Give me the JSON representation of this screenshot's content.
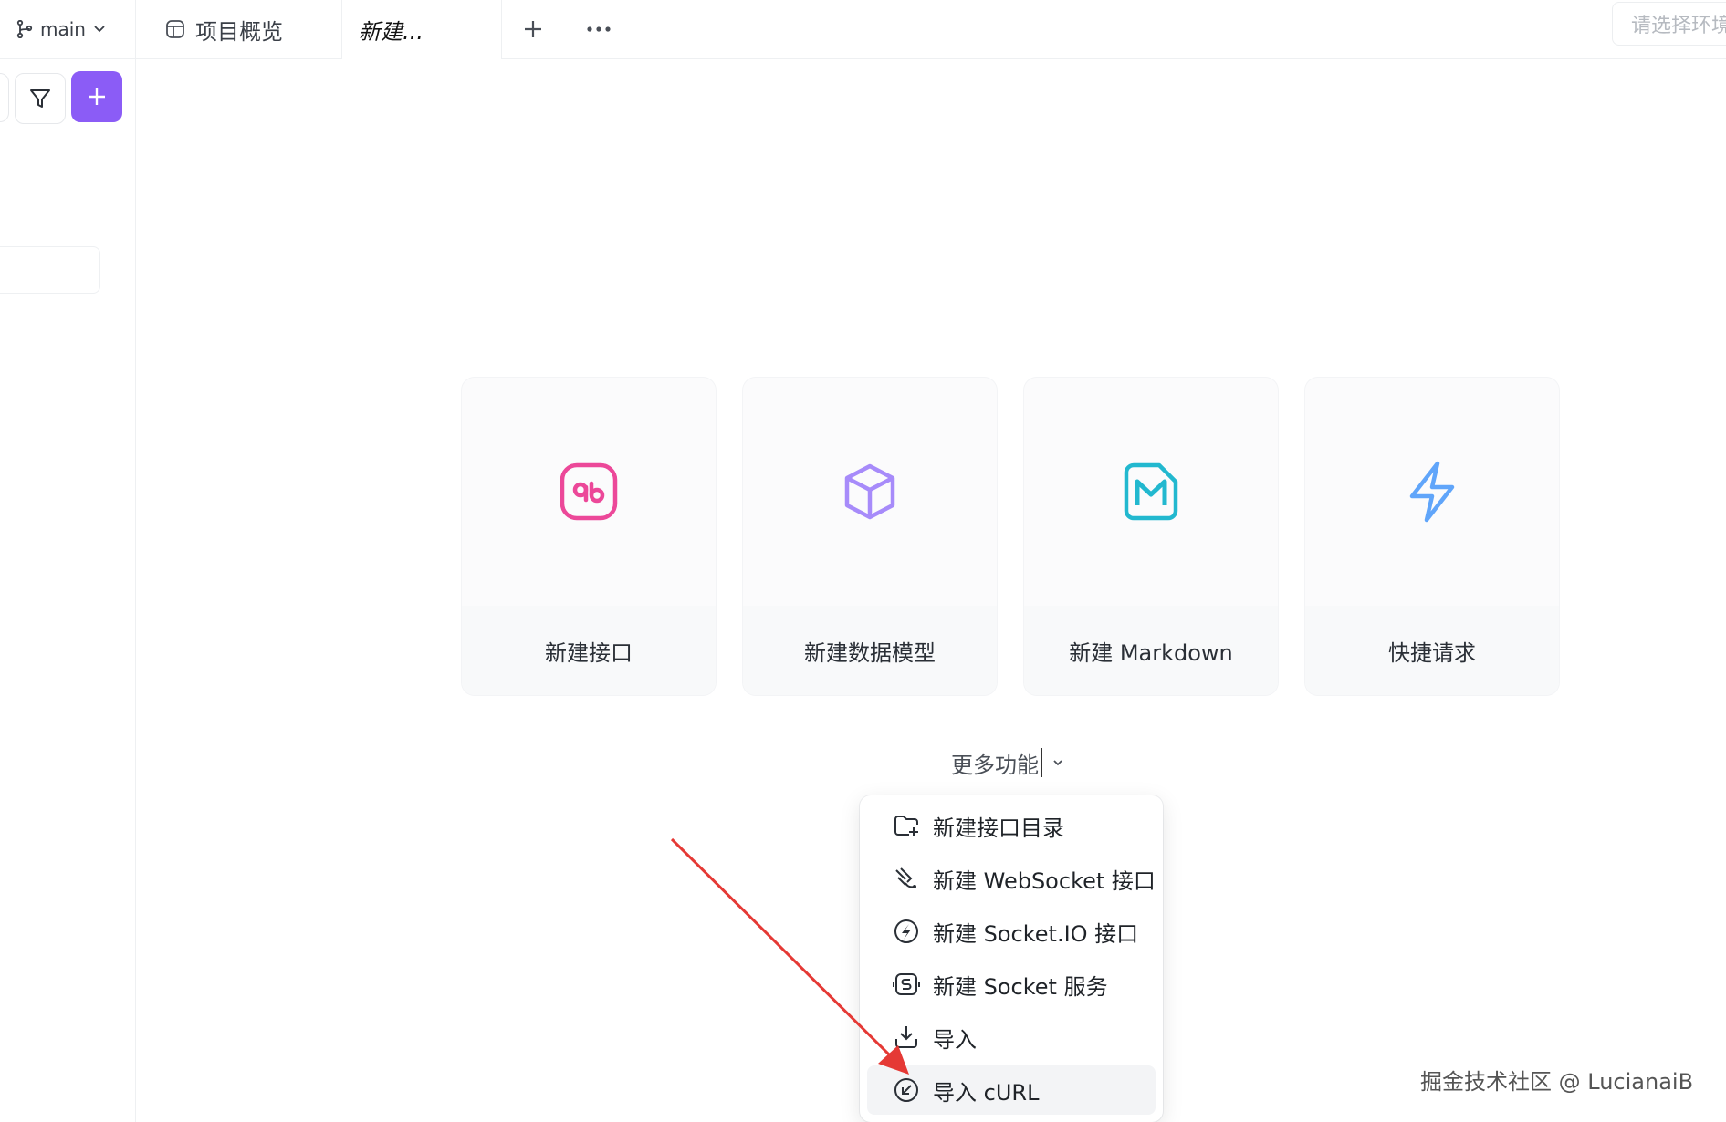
{
  "topbar": {
    "branch": "main",
    "tabs": [
      {
        "label": "项目概览"
      },
      {
        "label": "新建..."
      }
    ],
    "env_placeholder": "请选择环境"
  },
  "cards": [
    {
      "label": "新建接口",
      "icon": "api-icon",
      "color": "#ec4899"
    },
    {
      "label": "新建数据模型",
      "icon": "cube-icon",
      "color": "#a78bfa"
    },
    {
      "label": "新建 Markdown",
      "icon": "markdown-icon",
      "color": "#22b8cf"
    },
    {
      "label": "快捷请求",
      "icon": "lightning-icon",
      "color": "#60a5fa"
    }
  ],
  "more": {
    "label": "更多功能"
  },
  "menu": {
    "items": [
      {
        "label": "新建接口目录",
        "icon": "folder-add-icon"
      },
      {
        "label": "新建 WebSocket 接口",
        "icon": "websocket-icon"
      },
      {
        "label": "新建 Socket.IO 接口",
        "icon": "socketio-icon"
      },
      {
        "label": "新建 Socket 服务",
        "icon": "socket-service-icon"
      },
      {
        "label": "导入",
        "icon": "import-icon"
      },
      {
        "label": "导入 cURL",
        "icon": "import-curl-icon"
      }
    ]
  },
  "watermark": "掘金技术社区 @ LucianaiB",
  "colors": {
    "accent": "#8b5cf6",
    "annotation_arrow": "#e53935"
  }
}
